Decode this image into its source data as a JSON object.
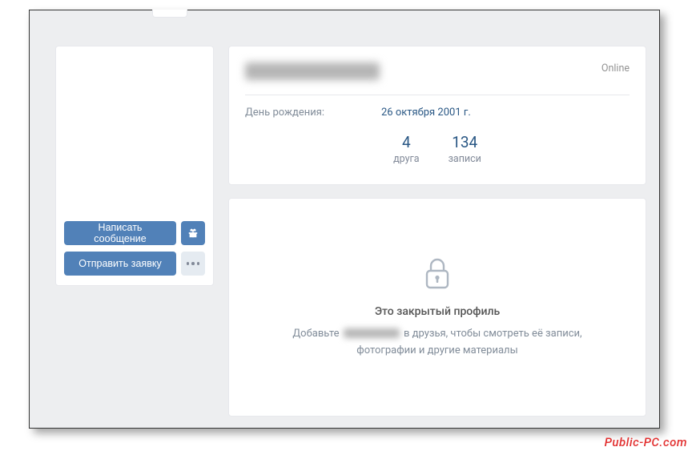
{
  "colors": {
    "accent": "#5181b8",
    "link": "#2a5885",
    "muted": "#818c99"
  },
  "sidebar": {
    "message_button_label": "Написать сообщение",
    "gift_icon_name": "gift-icon",
    "friend_request_button_label": "Отправить заявку",
    "more_icon_name": "more-icon"
  },
  "header": {
    "name_hidden": true,
    "status": "Online",
    "info": {
      "birthday_label": "День рождения:",
      "birthday_value": "26 октября 2001 г."
    },
    "counters": [
      {
        "value": "4",
        "label": "друга"
      },
      {
        "value": "134",
        "label": "записи"
      }
    ]
  },
  "private": {
    "title": "Это закрытый профиль",
    "subtitle_prefix": "Добавьте ",
    "subtitle_name_hidden": true,
    "subtitle_suffix_line1": " в друзья, чтобы смотреть её записи,",
    "subtitle_line2": "фотографии и другие материалы"
  },
  "watermark": "Public-PC.com"
}
